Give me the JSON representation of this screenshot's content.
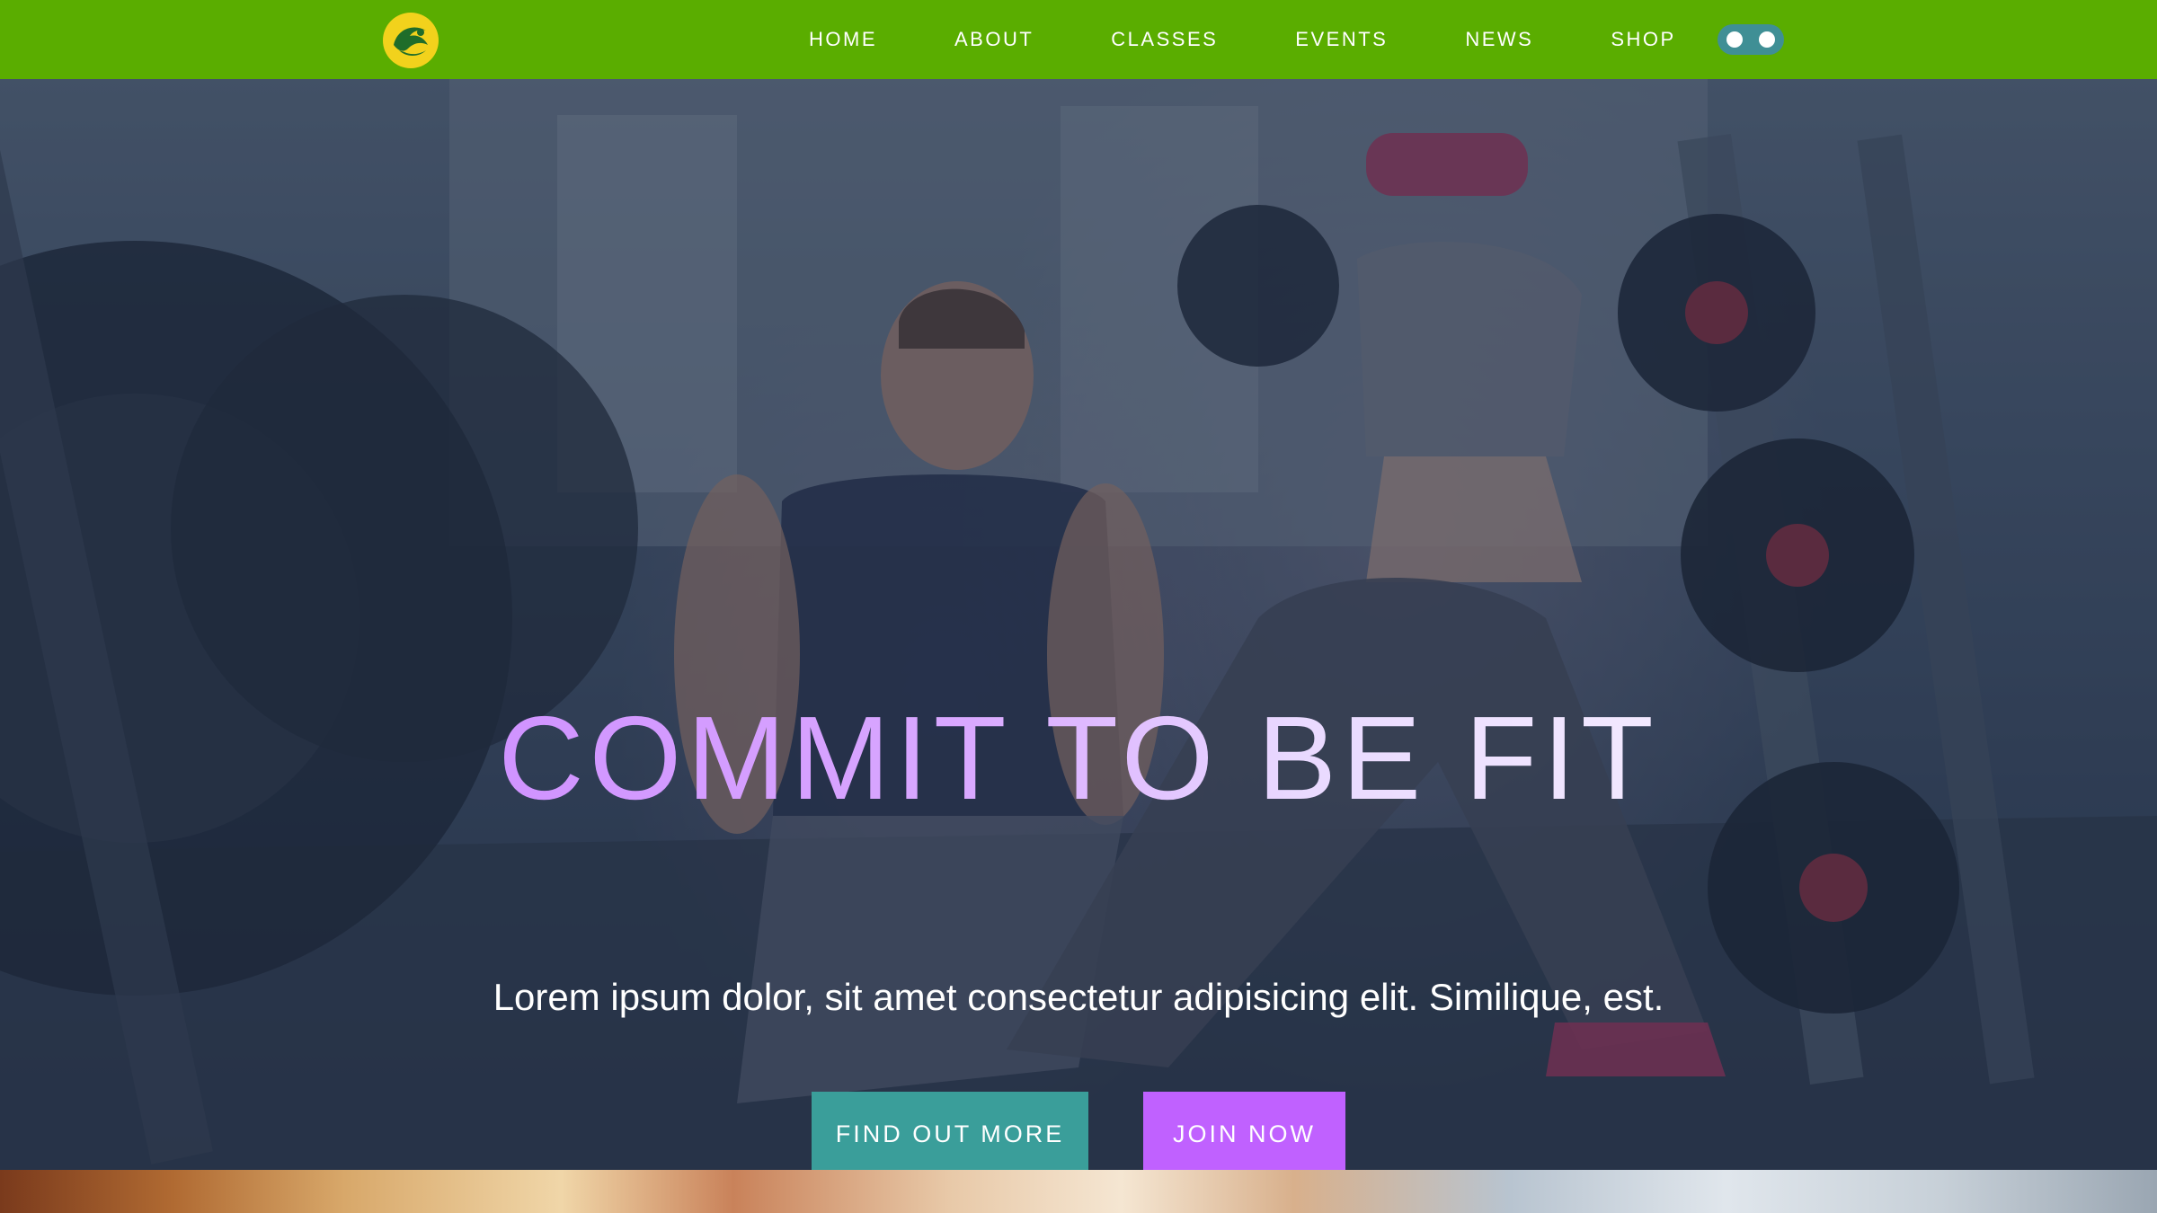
{
  "navbar": {
    "background_color": "#5aad00",
    "logo_icon": "fitness-logo-icon",
    "links": [
      {
        "label": "HOME"
      },
      {
        "label": "ABOUT"
      },
      {
        "label": "CLASSES"
      },
      {
        "label": "EVENTS"
      },
      {
        "label": "NEWS"
      },
      {
        "label": "SHOP"
      }
    ],
    "theme_toggle_icon": "theme-toggle-icon"
  },
  "hero": {
    "title": "COMMIT TO BE FIT",
    "subtitle": "Lorem ipsum dolor, sit amet consectetur adipisicing elit. Similique, est.",
    "buttons": {
      "find_out_more": "FIND OUT MORE",
      "join_now": "JOIN NOW"
    },
    "colors": {
      "title_gradient_start": "#c77dff",
      "find_button": "#3a9e9a",
      "join_button": "#c061ff"
    },
    "background_image": "gym-trainer-and-woman-lunge-photo"
  }
}
